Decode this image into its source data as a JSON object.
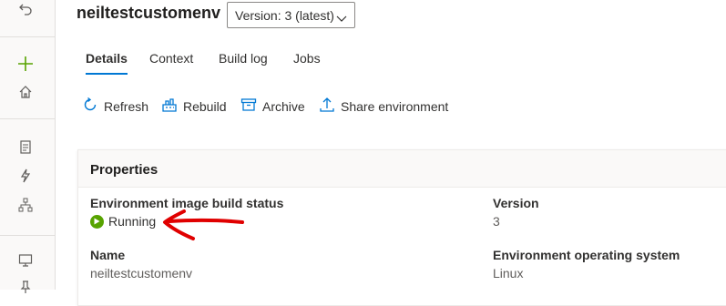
{
  "environment": {
    "name": "neiltestcustomenv",
    "version_dropdown": "Version: 3 (latest)"
  },
  "tabs": [
    {
      "label": "Details",
      "active": true
    },
    {
      "label": "Context",
      "active": false
    },
    {
      "label": "Build log",
      "active": false
    },
    {
      "label": "Jobs",
      "active": false
    }
  ],
  "toolbar": {
    "refresh": "Refresh",
    "rebuild": "Rebuild",
    "archive": "Archive",
    "share": "Share environment"
  },
  "properties": {
    "title": "Properties",
    "build_status_label": "Environment image build status",
    "build_status_value": "Running",
    "version_label": "Version",
    "version_value": "3",
    "name_label": "Name",
    "name_value": "neiltestcustomenv",
    "os_label": "Environment operating system",
    "os_value": "Linux"
  },
  "colors": {
    "accent": "#0078d4",
    "running": "#57a300",
    "annotation": "#e00000"
  },
  "sidebar_icons": [
    "undo-icon",
    "plus-icon",
    "home-icon",
    "clipboard-icon",
    "lightning-icon",
    "hierarchy-icon",
    "monitor-icon",
    "pin-icon"
  ]
}
